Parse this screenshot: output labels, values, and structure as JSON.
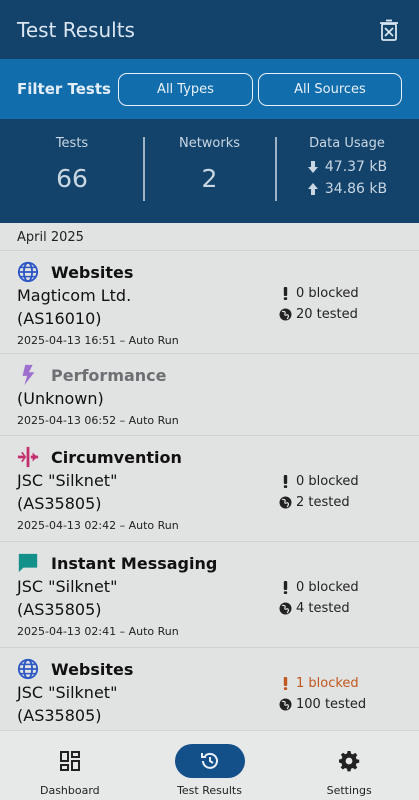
{
  "appbar": {
    "title": "Test Results",
    "delete_icon": "delete-history-icon"
  },
  "filter": {
    "label": "Filter Tests",
    "types": "All Types",
    "sources": "All Sources"
  },
  "stats": {
    "tests_label": "Tests",
    "tests_value": "66",
    "networks_label": "Networks",
    "networks_value": "2",
    "usage_label": "Data Usage",
    "download": "47.37 kB",
    "upload": "34.86 kB"
  },
  "list": {
    "month": "April 2025",
    "items": [
      {
        "icon": "globe-icon",
        "type": "Websites",
        "network_name": "Magticom Ltd.",
        "asn": "(AS16010)",
        "meta": "2025-04-13 16:51 – Auto Run",
        "blocked": "0 blocked",
        "tested": "20 tested"
      },
      {
        "icon": "bolt-icon",
        "type": "Performance",
        "network_name": "(Unknown)",
        "meta": "2025-04-13 06:52 – Auto Run"
      },
      {
        "icon": "circumvention-icon",
        "type": "Circumvention",
        "network_name": "JSC \"Silknet\"",
        "asn": "(AS35805)",
        "meta": "2025-04-13 02:42 – Auto Run",
        "blocked": "0 blocked",
        "tested": "2 tested"
      },
      {
        "icon": "chat-icon",
        "type": "Instant Messaging",
        "network_name": "JSC \"Silknet\"",
        "asn": "(AS35805)",
        "meta": "2025-04-13 02:41 – Auto Run",
        "blocked": "0 blocked",
        "tested": "4 tested"
      },
      {
        "icon": "globe-icon",
        "type": "Websites",
        "network_name": "JSC \"Silknet\"",
        "asn": "(AS35805)",
        "blocked": "1 blocked",
        "tested": "100 tested"
      }
    ]
  },
  "colors": {
    "accent": "#116dab",
    "dark": "#13426a",
    "alert": "#c2571d",
    "globe": "#2d57c4",
    "bolt": "#9f6fcf",
    "circ": "#c32f6c",
    "chat": "#13908a"
  },
  "nav": {
    "dashboard": "Dashboard",
    "results": "Test Results",
    "settings": "Settings"
  }
}
